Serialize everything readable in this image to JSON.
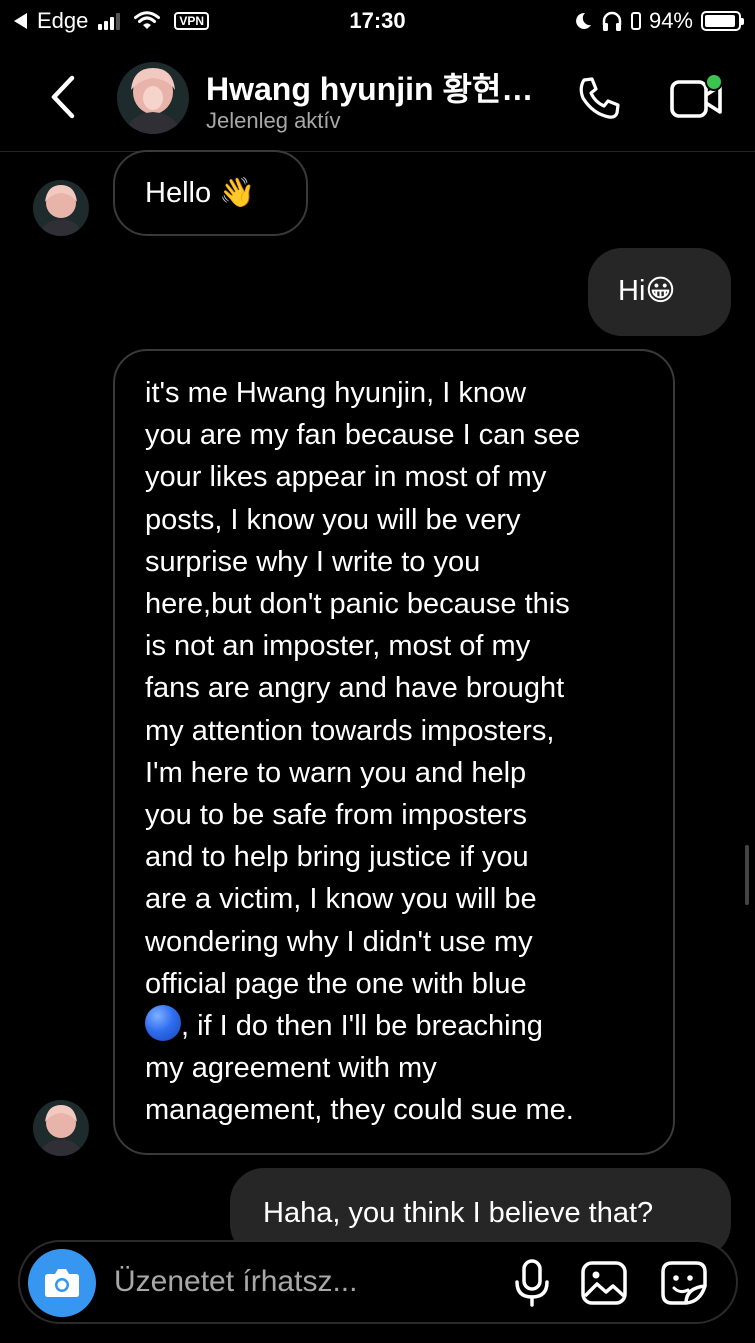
{
  "status_bar": {
    "carrier": "Edge",
    "vpn": "VPN",
    "time": "17:30",
    "battery_percent": "94%",
    "battery_level": 0.94
  },
  "header": {
    "name": "Hwang hyunjin 황현…",
    "status": "Jelenleg aktív",
    "active_dot_color": "#3bc351"
  },
  "messages": [
    {
      "direction": "incoming",
      "text": "Hello",
      "emoji": "👋"
    },
    {
      "direction": "outgoing",
      "text": "Hi",
      "emoji": "😀"
    },
    {
      "direction": "incoming",
      "lines": [
        "it's me Hwang hyunjin, I know",
        "you are my fan because I can see",
        "your likes appear in most of my",
        "posts, I know you will be very",
        "surprise why I write to you",
        "here,but don't panic because this",
        "is not an imposter, most of my",
        "fans are angry and have brought",
        "my attention towards imposters,",
        "I'm here to warn you and help",
        "you to be safe from imposters",
        "and to help bring justice if you",
        "are a victim, I know you will be",
        "wondering why I didn't use my",
        "official page the one with blue"
      ],
      "line_with_dot": ", if I do then I'll be breaching",
      "lines_after": [
        "my agreement with my",
        "management, they could sue me."
      ]
    },
    {
      "direction": "outgoing",
      "text": "Haha, you think I believe that?"
    }
  ],
  "composer": {
    "placeholder": "Üzenetet írhatsz..."
  },
  "colors": {
    "background": "#000000",
    "outgoing_bubble": "#262626",
    "incoming_border": "#3a3a3a",
    "camera_button": "#3797f0",
    "secondary_text": "#a8a8a8"
  },
  "icons": [
    "back-arrow-icon",
    "phone-icon",
    "video-call-icon",
    "camera-icon",
    "microphone-icon",
    "gallery-icon",
    "sticker-icon"
  ]
}
